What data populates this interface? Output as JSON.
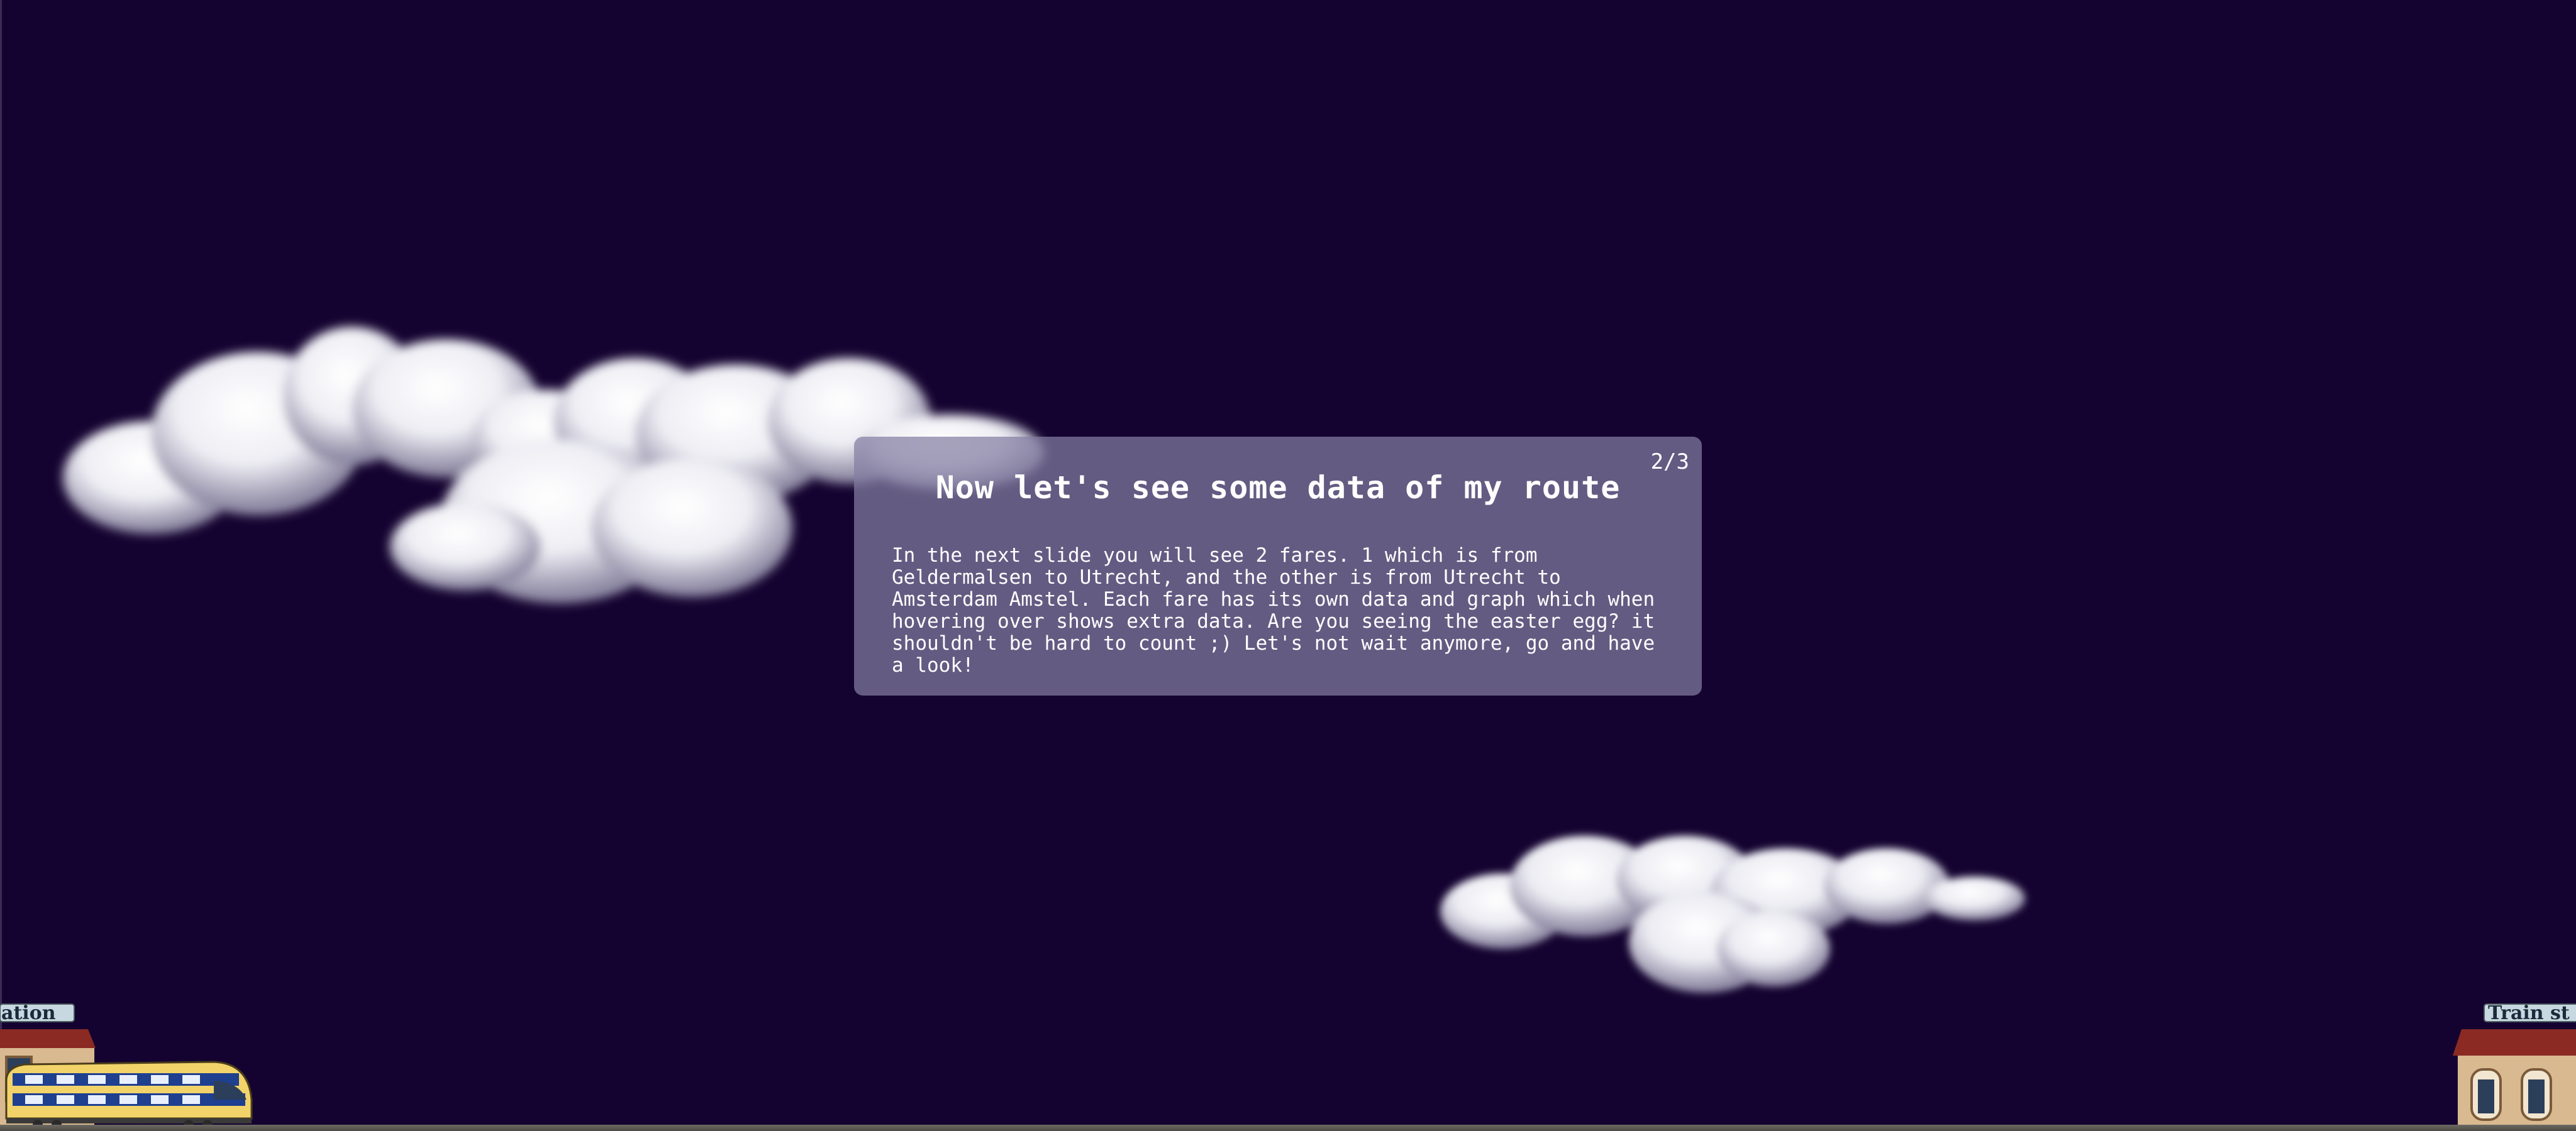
{
  "card": {
    "counter": "2/3",
    "title": "Now let's see some data of my route",
    "body": "In the next slide you will see 2 fares. 1 which is from Geldermalsen to Utrecht, and the other is from Utrecht to Amsterdam Amstel. Each fare has its own data and graph which when hovering over shows extra data. Are you seeing the easter egg? it shouldn't be hard to count ;) Let's not wait anymore, go and have a look!"
  },
  "stations": {
    "left_sign": "ation",
    "right_sign": "Train st"
  },
  "colors": {
    "background": "#140330",
    "card": "#847ea2",
    "train_yellow": "#f1d36a",
    "train_blue": "#1f3f8f",
    "roof_red": "#8a2a22"
  },
  "icons": {
    "train": "train-icon",
    "station_left": "station-building-icon",
    "station_right": "station-building-icon",
    "cloud": "cloud-icon"
  }
}
